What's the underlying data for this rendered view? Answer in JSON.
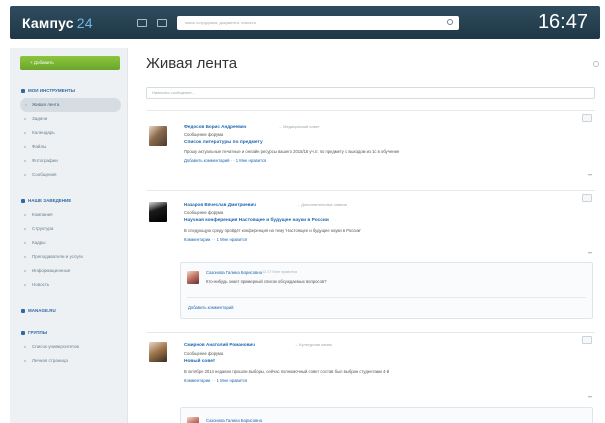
{
  "header": {
    "logo": "Кампус",
    "logo_num": "24",
    "search_placeholder": "поиск сотрудника, документа, новости",
    "clock": "16:47"
  },
  "sidebar": {
    "add_button": "+ Добавить",
    "sections": [
      {
        "title": "МОИ ИНСТРУМЕНТЫ",
        "items": [
          "Живая лента",
          "Задачи",
          "Календарь",
          "Файлы",
          "Фотографии",
          "Сообщения"
        ],
        "active_index": 0
      },
      {
        "title": "НАШЕ ЗАВЕДЕНИЕ",
        "items": [
          "Компания",
          "Структура",
          "Кадры",
          "Преподаватели и услуги",
          "Информационные",
          "Новость"
        ]
      },
      {
        "title": "MANAGE.RU",
        "items": []
      },
      {
        "title": "ГРУППЫ",
        "items": [
          "Список университетов",
          "Личная страница"
        ]
      }
    ]
  },
  "main": {
    "title": "Живая лента",
    "composer_placeholder": "Написать сообщение...",
    "posts": [
      {
        "author": "Федосов Борис Андреевич",
        "author_sub": "→ Медицинский совет",
        "type": "Сообщение форума",
        "title": "Список литературы по предмету",
        "body": "Прошу актуальные печатные и онлайн ресурсы вашего 2015/16 уч.гг. по предмету с выходом из 1с в обучение",
        "actions": "Добавить комментарий · · 1 Мне нравится"
      },
      {
        "author": "Назаров Вячеслав Дмитриевич",
        "author_sub": "→ Дополнительные знания",
        "type": "Сообщение форума",
        "title": "Научная конференция Настоящее и будущее науки в России",
        "body": "В следующую среду пройдёт конференция на тему 'Настоящее и будущее науки в России'",
        "actions": "Комментарии · · 1 Мне нравится",
        "comment": {
          "author": "Сазонова Галина Борисовна",
          "meta": "12.07 Мне нравится",
          "text": "Кто-нибудь знает примерный список обсуждаемых вопросов?",
          "add": "Добавить комментарий"
        }
      },
      {
        "author": "Смирнов Анатолий Романович",
        "author_sub": "→ Культурная жизнь",
        "type": "Сообщение форума",
        "title": "Новый совет",
        "body": "В октябре 2014 недавно прошли выборы, сейчас полномочный совет состав был выбран студентами 4-й",
        "actions": "Комментарии · · 1 Мне нравится",
        "comment": {
          "author": "Сазонова Галина Борисовна"
        }
      }
    ]
  }
}
